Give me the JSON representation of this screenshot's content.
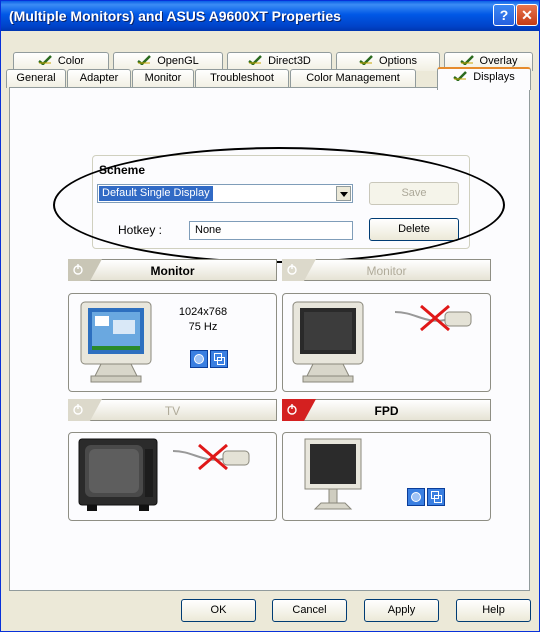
{
  "window": {
    "title": "(Multiple Monitors) and ASUS A9600XT Properties",
    "help_label": "?",
    "close_label": "✕"
  },
  "tabs": {
    "top_row": [
      {
        "label": "Color"
      },
      {
        "label": "OpenGL"
      },
      {
        "label": "Direct3D"
      },
      {
        "label": "Options"
      },
      {
        "label": "Overlay"
      }
    ],
    "bottom_row": [
      {
        "label": "General"
      },
      {
        "label": "Adapter"
      },
      {
        "label": "Monitor"
      },
      {
        "label": "Troubleshoot"
      },
      {
        "label": "Color Management"
      },
      {
        "label": "Displays"
      }
    ],
    "active": "Displays"
  },
  "scheme": {
    "label": "Scheme",
    "selected": "Default Single Display",
    "save_label": "Save",
    "delete_label": "Delete",
    "hotkey_label": "Hotkey :",
    "hotkey_value": "None"
  },
  "displays": [
    {
      "label": "Monitor",
      "enabled": true,
      "resolution": "1024x768",
      "refresh": "75 Hz",
      "connected": true
    },
    {
      "label": "Monitor",
      "enabled": false,
      "connected": false
    },
    {
      "label": "TV",
      "enabled": false,
      "connected": false
    },
    {
      "label": "FPD",
      "enabled": true,
      "connected": true
    }
  ],
  "footer": {
    "ok_label": "OK",
    "cancel_label": "Cancel",
    "apply_label": "Apply",
    "help_label": "Help"
  },
  "colors": {
    "title_bar": "#0058e6",
    "active_tab_accent": "#e68b2c",
    "selection": "#316ac5",
    "enabled_tag": "#d42020",
    "annotation_ellipse": "#000000"
  }
}
